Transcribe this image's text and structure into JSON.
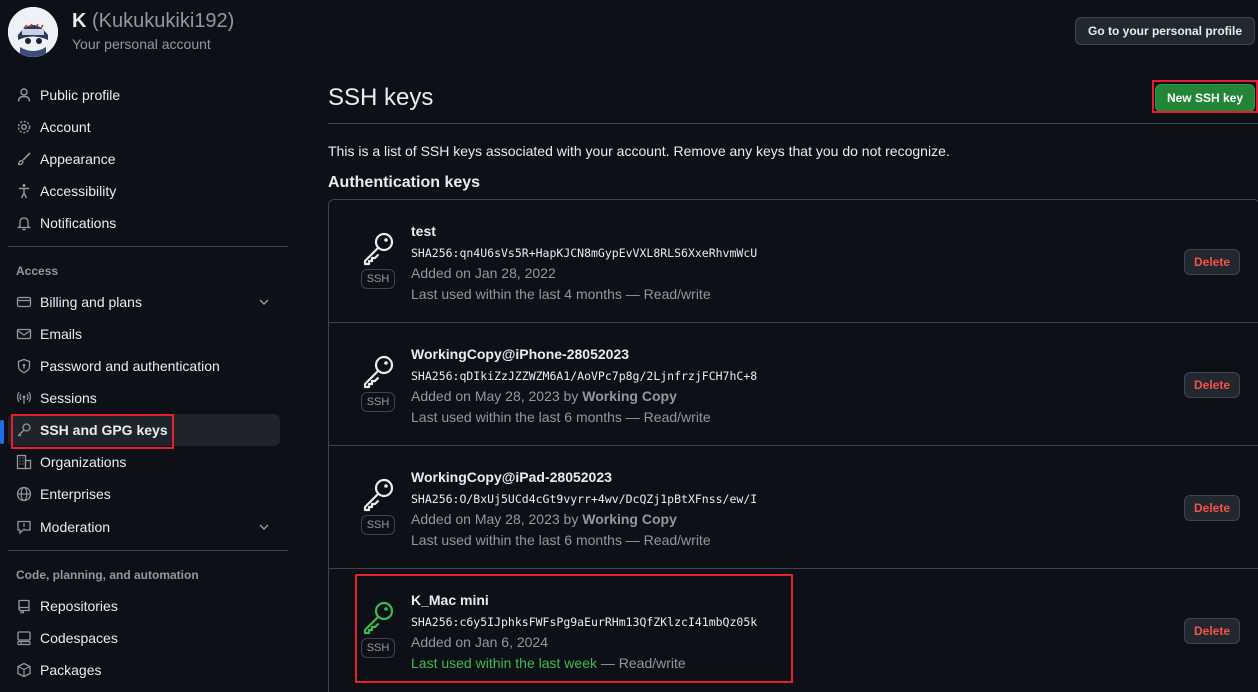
{
  "account": {
    "name": "K",
    "login": "(Kukukukiki192)",
    "subtitle": "Your personal account",
    "profile_button": "Go to your personal profile"
  },
  "sidebar": {
    "items": [
      {
        "label": "Public profile",
        "icon": "person-icon"
      },
      {
        "label": "Account",
        "icon": "gear-icon"
      },
      {
        "label": "Appearance",
        "icon": "paintbrush-icon"
      },
      {
        "label": "Accessibility",
        "icon": "accessibility-icon"
      },
      {
        "label": "Notifications",
        "icon": "bell-icon"
      }
    ],
    "access_heading": "Access",
    "access_items": [
      {
        "label": "Billing and plans",
        "icon": "credit-card-icon"
      },
      {
        "label": "Emails",
        "icon": "mail-icon"
      },
      {
        "label": "Password and authentication",
        "icon": "shield-lock-icon"
      },
      {
        "label": "Sessions",
        "icon": "broadcast-icon"
      },
      {
        "label": "SSH and GPG keys",
        "icon": "key-icon"
      },
      {
        "label": "Organizations",
        "icon": "organization-icon"
      },
      {
        "label": "Enterprises",
        "icon": "globe-icon"
      },
      {
        "label": "Moderation",
        "icon": "report-icon"
      }
    ],
    "code_heading": "Code, planning, and automation",
    "code_items": [
      {
        "label": "Repositories",
        "icon": "repo-icon"
      },
      {
        "label": "Codespaces",
        "icon": "codespaces-icon"
      },
      {
        "label": "Packages",
        "icon": "package-icon"
      }
    ]
  },
  "main": {
    "title": "SSH keys",
    "new_button": "New SSH key",
    "intro": "This is a list of SSH keys associated with your account. Remove any keys that you do not recognize.",
    "section_heading": "Authentication keys",
    "badge": "SSH",
    "delete_label": "Delete",
    "keys": [
      {
        "title": "test",
        "fingerprint": "SHA256:qn4U6sVs5R+HapKJCN8mGypEvVXL8RLS6XxeRhvmWcU",
        "added": "Added on Jan 28, 2022",
        "added_by": "",
        "last_used": "Last used within the last 4 months",
        "access": " — Read/write"
      },
      {
        "title": "WorkingCopy@iPhone-28052023",
        "fingerprint": "SHA256:qDIkiZzJZZWZM6A1/AoVPc7p8g/2LjnfrzjFCH7hC+8",
        "added": "Added on May 28, 2023 by ",
        "added_by": "Working Copy",
        "last_used": "Last used within the last 6 months",
        "access": " — Read/write"
      },
      {
        "title": "WorkingCopy@iPad-28052023",
        "fingerprint": "SHA256:O/BxUj5UCd4cGt9vyrr+4wv/DcQZj1pBtXFnss/ew/I",
        "added": "Added on May 28, 2023 by ",
        "added_by": "Working Copy",
        "last_used": "Last used within the last 6 months",
        "access": " — Read/write"
      },
      {
        "title": "K_Mac mini",
        "fingerprint": "SHA256:c6y5IJphksFWFsPg9aEurRHm13QfZKlzcI41mbQz05k",
        "added": "Added on Jan 6, 2024",
        "added_by": "",
        "last_used": "Last used within the last week",
        "access": " — Read/write"
      }
    ]
  },
  "colors": {
    "background": "#0d1117",
    "accent_blue": "#1f6feb",
    "green": "#238636",
    "recent_green": "#3fb950",
    "danger": "#f85149",
    "highlight": "#e5202c"
  }
}
